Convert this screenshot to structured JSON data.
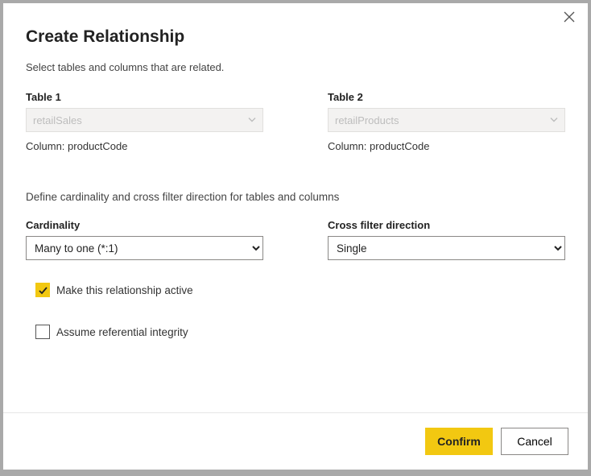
{
  "dialog": {
    "title": "Create Relationship",
    "subtitle": "Select tables and columns that are related."
  },
  "table1": {
    "label": "Table 1",
    "value": "retailSales",
    "column_label": "Column:",
    "column_value": "productCode"
  },
  "table2": {
    "label": "Table 2",
    "value": "retailProducts",
    "column_label": "Column:",
    "column_value": "productCode"
  },
  "define_text": "Define cardinality and cross filter direction for tables and columns",
  "cardinality": {
    "label": "Cardinality",
    "value": "Many to one (*:1)"
  },
  "crossfilter": {
    "label": "Cross filter direction",
    "value": "Single"
  },
  "checkbox_active": {
    "label": "Make this relationship active",
    "checked": true
  },
  "checkbox_integrity": {
    "label": "Assume referential integrity",
    "checked": false
  },
  "footer": {
    "confirm": "Confirm",
    "cancel": "Cancel"
  }
}
